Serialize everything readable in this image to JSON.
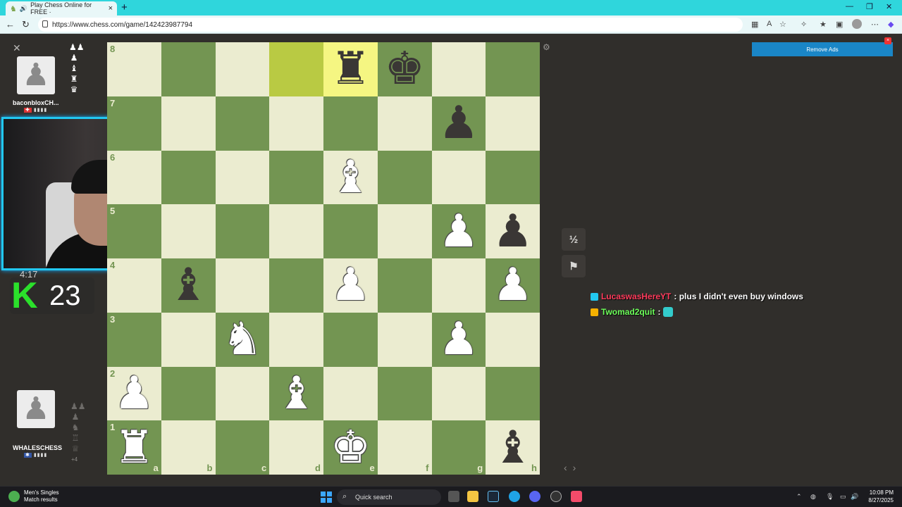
{
  "browser": {
    "tab_title": "Play Chess Online for FREE ·",
    "url": "https://www.chess.com/game/142423987794"
  },
  "top_player": {
    "name": "baconbloxCH...",
    "captured": [
      "♟♟",
      "♟",
      "♝",
      "♜",
      "♛"
    ]
  },
  "bottom_player": {
    "name": "WHALESCHESS",
    "captured": [
      "♟♟",
      "♟",
      "♞",
      "♖",
      "♕"
    ],
    "advantage": "+4"
  },
  "overlay": {
    "timer": "4:17",
    "k_letter": "K",
    "k_count": "23"
  },
  "board": {
    "ranks": [
      "8",
      "7",
      "6",
      "5",
      "4",
      "3",
      "2",
      "1"
    ],
    "files": [
      "a",
      "b",
      "c",
      "d",
      "e",
      "f",
      "g",
      "h"
    ],
    "highlight": [
      "d8",
      "e8"
    ],
    "pieces": {
      "e8": "bR",
      "f8": "bK",
      "g7": "bP",
      "e6": "wB",
      "g5": "wP",
      "h5": "bP",
      "b4": "bB",
      "e4": "wP",
      "h4": "wP",
      "c3": "wN",
      "g3": "wP",
      "a2": "wP",
      "d2": "wB",
      "a1": "wR",
      "e1": "wK",
      "h1": "bB"
    }
  },
  "buttons": {
    "draw": "½",
    "resign": "⚑",
    "remove_ads": "Remove Ads"
  },
  "chat": [
    {
      "user": "LucaswasHereYT",
      "user_color": "#ff3b5c",
      "badge_color": "#22c8f0",
      "message": ": plus I didn't even buy windows"
    },
    {
      "user": "Twomad2quit",
      "user_color": "#6dff5a",
      "badge_color": "#f5b100",
      "message": ":"
    }
  ],
  "taskbar": {
    "news_title": "Men's Singles",
    "news_sub": "Match results",
    "search_placeholder": "Quick search",
    "time": "10:08 PM",
    "date": "8/27/2025"
  }
}
